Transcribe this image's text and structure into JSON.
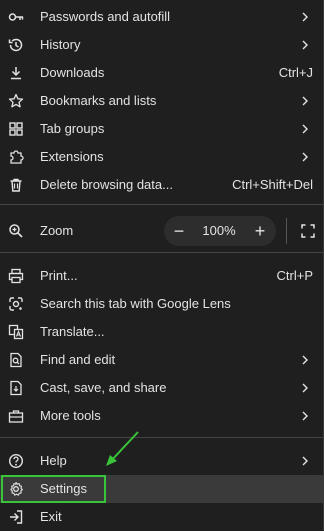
{
  "menu": {
    "items_top": [
      {
        "label": "Passwords and autofill",
        "icon": "key-icon",
        "shortcut": "",
        "submenu": true
      },
      {
        "label": "History",
        "icon": "history-icon",
        "shortcut": "",
        "submenu": true
      },
      {
        "label": "Downloads",
        "icon": "download-icon",
        "shortcut": "Ctrl+J",
        "submenu": false
      },
      {
        "label": "Bookmarks and lists",
        "icon": "star-icon",
        "shortcut": "",
        "submenu": true
      },
      {
        "label": "Tab groups",
        "icon": "grid-icon",
        "shortcut": "",
        "submenu": true
      },
      {
        "label": "Extensions",
        "icon": "puzzle-icon",
        "shortcut": "",
        "submenu": true
      },
      {
        "label": "Delete browsing data...",
        "icon": "trash-icon",
        "shortcut": "Ctrl+Shift+Del",
        "submenu": false
      }
    ],
    "zoom": {
      "label": "Zoom",
      "icon": "zoom-icon",
      "minus": "−",
      "plus": "+",
      "value": "100%"
    },
    "items_mid": [
      {
        "label": "Print...",
        "icon": "print-icon",
        "shortcut": "Ctrl+P",
        "submenu": false
      },
      {
        "label": "Search this tab with Google Lens",
        "icon": "lens-icon",
        "shortcut": "",
        "submenu": false
      },
      {
        "label": "Translate...",
        "icon": "translate-icon",
        "shortcut": "",
        "submenu": false
      },
      {
        "label": "Find and edit",
        "icon": "find-icon",
        "shortcut": "",
        "submenu": true
      },
      {
        "label": "Cast, save, and share",
        "icon": "cast-icon",
        "shortcut": "",
        "submenu": true
      },
      {
        "label": "More tools",
        "icon": "toolbox-icon",
        "shortcut": "",
        "submenu": true
      }
    ],
    "items_bottom": [
      {
        "label": "Help",
        "icon": "help-icon",
        "shortcut": "",
        "submenu": true
      },
      {
        "label": "Settings",
        "icon": "gear-icon",
        "shortcut": "",
        "submenu": false
      },
      {
        "label": "Exit",
        "icon": "exit-icon",
        "shortcut": "",
        "submenu": false
      }
    ]
  },
  "colors": {
    "background": "#1f1f1f",
    "text": "#e3e3e3",
    "highlight": "#3a3a3a",
    "annotation": "#3ac43a"
  }
}
